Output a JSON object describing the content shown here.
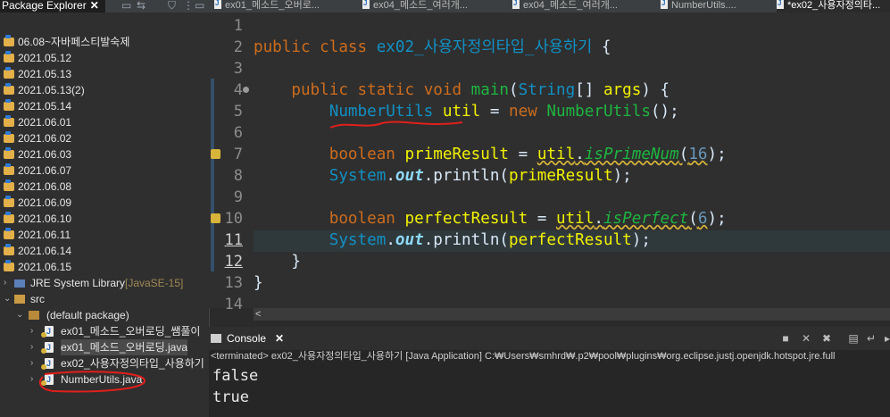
{
  "explorer": {
    "tab_label": "Package Explorer",
    "close": "✕",
    "projects": [
      "06.08~자바페스티발숙제",
      "2021.05.12",
      "2021.05.13",
      "2021.05.13(2)",
      "2021.05.14",
      "2021.06.01",
      "2021.06.02",
      "2021.06.03",
      "2021.06.07",
      "2021.06.08",
      "2021.06.09",
      "2021.06.10",
      "2021.06.11",
      "2021.06.14",
      "2021.06.15"
    ],
    "jre": "JRE System Library",
    "jre_version": "[JavaSE-15]",
    "src": "src",
    "package": "(default package)",
    "files": [
      "ex01_메소드_오버로딩_쌤풀이",
      "ex01_메소드_오버로딩.java",
      "ex02_사용자정의타입_사용하기",
      "NumberUtils.java"
    ]
  },
  "tabs": [
    "ex01_메소드_오버로...",
    "ex04_메소드_여러개...",
    "ex04_메소드_여러개...",
    "NumberUtils....",
    "*ex02_사용자정의타..."
  ],
  "editor": {
    "line_numbers": [
      "1",
      "2",
      "3",
      "4",
      "5",
      "6",
      "7",
      "8",
      "9",
      "10",
      "11",
      "12",
      "13",
      "14"
    ],
    "class_name": "ex02_사용자정의타입_사용하기",
    "num_prime": "16",
    "num_perfect": "6"
  },
  "scroll_arrow": "<",
  "console": {
    "tab_label": "Console",
    "close": "✕",
    "status": "<terminated> ex02_사용자정의타입_사용하기 [Java Application] C:₩Users₩smhrd₩.p2₩pool₩plugins₩org.eclipse.justj.openjdk.hotspot.jre.full",
    "output": [
      "false",
      "true"
    ]
  }
}
